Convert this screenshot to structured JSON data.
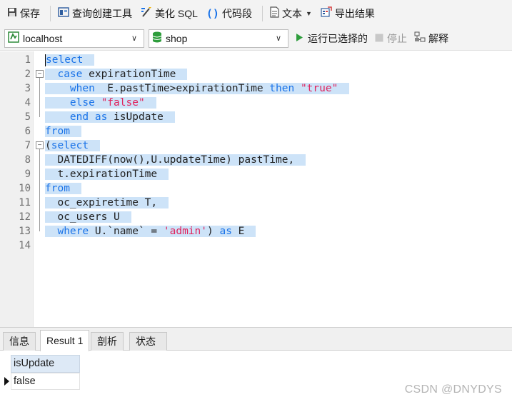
{
  "toolbar": {
    "save_label": "保存",
    "query_builder_label": "查询创建工具",
    "beautify_label": "美化 SQL",
    "snippet_label": "代码段",
    "text_label": "文本",
    "export_label": "导出结果"
  },
  "connection": {
    "server_value": "localhost",
    "database_value": "shop",
    "run_selected_label": "运行已选择的",
    "stop_label": "停止",
    "explain_label": "解释"
  },
  "editor": {
    "line_numbers": [
      "1",
      "2",
      "3",
      "4",
      "5",
      "6",
      "7",
      "8",
      "9",
      "10",
      "11",
      "12",
      "13",
      "14"
    ],
    "lines": [
      [
        {
          "t": "kw",
          "v": "select"
        }
      ],
      [
        {
          "t": "txt",
          "v": "  "
        },
        {
          "t": "kw",
          "v": "case"
        },
        {
          "t": "txt",
          "v": " expirationTime"
        }
      ],
      [
        {
          "t": "txt",
          "v": "    "
        },
        {
          "t": "kw",
          "v": "when"
        },
        {
          "t": "txt",
          "v": "  E.pastTime>expirationTime "
        },
        {
          "t": "kw",
          "v": "then"
        },
        {
          "t": "txt",
          "v": " "
        },
        {
          "t": "str",
          "v": "\"true\""
        }
      ],
      [
        {
          "t": "txt",
          "v": "    "
        },
        {
          "t": "kw",
          "v": "else"
        },
        {
          "t": "txt",
          "v": " "
        },
        {
          "t": "str",
          "v": "\"false\""
        }
      ],
      [
        {
          "t": "txt",
          "v": "    "
        },
        {
          "t": "kw",
          "v": "end"
        },
        {
          "t": "txt",
          "v": " "
        },
        {
          "t": "kw",
          "v": "as"
        },
        {
          "t": "txt",
          "v": " isUpdate"
        }
      ],
      [
        {
          "t": "kw",
          "v": "from"
        }
      ],
      [
        {
          "t": "txt",
          "v": "("
        },
        {
          "t": "kw",
          "v": "select"
        }
      ],
      [
        {
          "t": "txt",
          "v": "  DATEDIFF(now(),U.updateTime) pastTime,"
        }
      ],
      [
        {
          "t": "txt",
          "v": "  t.expirationTime"
        }
      ],
      [
        {
          "t": "kw",
          "v": "from"
        }
      ],
      [
        {
          "t": "txt",
          "v": "  oc_expiretime T,"
        }
      ],
      [
        {
          "t": "txt",
          "v": "  oc_users U"
        }
      ],
      [
        {
          "t": "txt",
          "v": "  "
        },
        {
          "t": "kw",
          "v": "where"
        },
        {
          "t": "txt",
          "v": " U.`name` = "
        },
        {
          "t": "str",
          "v": "'admin'"
        },
        {
          "t": "txt",
          "v": ") "
        },
        {
          "t": "kw",
          "v": "as"
        },
        {
          "t": "txt",
          "v": " E"
        }
      ],
      []
    ],
    "colors": {
      "keyword": "#1a73e8",
      "string": "#e0245e",
      "selection": "#cde3f8"
    }
  },
  "results": {
    "tabs": [
      "信息",
      "Result 1",
      "剖析",
      "状态"
    ],
    "active_tab": "Result 1",
    "columns": [
      "isUpdate"
    ],
    "rows": [
      [
        "false"
      ]
    ]
  },
  "watermark": "CSDN @DNYDYS",
  "icons": {
    "save": "save-icon",
    "query_builder": "query-builder-icon",
    "beautify": "beautify-sql-icon",
    "snippet": "code-snippet-icon",
    "text": "text-icon",
    "export": "export-icon",
    "server": "server-icon",
    "database": "database-icon",
    "run": "play-icon",
    "stop": "stop-icon",
    "explain": "explain-icon"
  }
}
